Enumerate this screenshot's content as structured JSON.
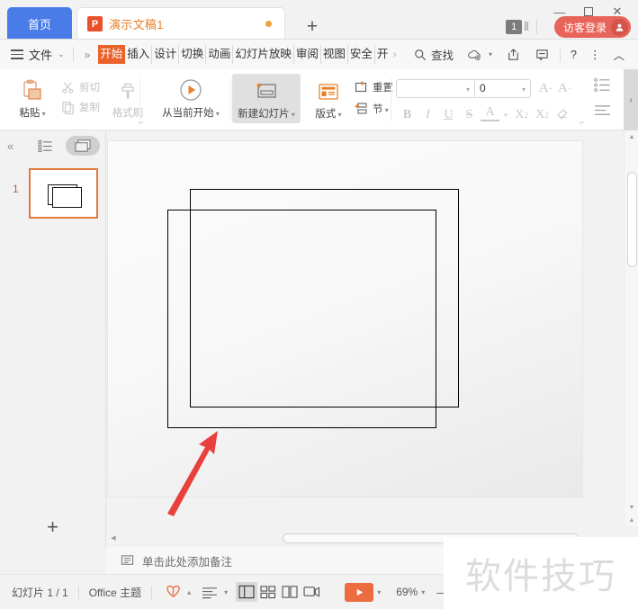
{
  "titlebar": {
    "home_tab": "首页",
    "doc_tab": {
      "icon_letter": "P",
      "label": "演示文稿1"
    },
    "add_tab": "+",
    "window_controls": {
      "minimize": "—",
      "maximize": "▢",
      "close": "✕"
    },
    "counter": "1",
    "guest": {
      "label": "访客登录",
      "avatar_glyph": "👤"
    }
  },
  "menubar": {
    "file": "文件",
    "file_caret": "⌄",
    "expand_more": "»",
    "tabs": [
      {
        "label": "开始",
        "active": true
      },
      {
        "label": "插入",
        "active": false
      },
      {
        "label": "设计",
        "active": false
      },
      {
        "label": "切换",
        "active": false
      },
      {
        "label": "动画",
        "active": false
      },
      {
        "label": "幻灯片放映",
        "active": false
      },
      {
        "label": "审阅",
        "active": false
      },
      {
        "label": "视图",
        "active": false
      },
      {
        "label": "安全",
        "active": false
      },
      {
        "label": "开",
        "active": false
      }
    ],
    "tabs_overflow": "›",
    "search": "查找",
    "cloud_caret": "▾",
    "help": "?",
    "more": "⋮",
    "collapse": "︿"
  },
  "ribbon": {
    "clipboard": {
      "paste": "粘贴",
      "paste_caret": "▾",
      "cut": "剪切",
      "copy": "复制",
      "format_painter": "格式刷"
    },
    "start_show": {
      "label": "从当前开始",
      "caret": "▾"
    },
    "slides": {
      "new_slide": "新建幻灯片",
      "new_slide_caret": "▾",
      "layout": "版式",
      "layout_caret": "▾",
      "reset": "重置",
      "section": "节",
      "section_caret": "▾"
    },
    "font": {
      "name_value": "",
      "name_placeholder": "",
      "size_value": "0",
      "grow": "A",
      "grow_sup": "+",
      "shrink": "A",
      "shrink_sup": "−",
      "bold": "B",
      "italic": "I",
      "underline": "U",
      "strikethrough": "S",
      "text_color": "A",
      "text_color_caret": "▾",
      "superscript": "X",
      "superscript_sup": "2",
      "subscript": "X",
      "subscript_sub": "2",
      "clear_format": "◇"
    },
    "collapse_arrow": "›"
  },
  "left_panel": {
    "collapse": "«",
    "outline_view": "outline",
    "slide_view": "slides",
    "slides": [
      {
        "number": "1"
      }
    ],
    "add_slide": "+"
  },
  "canvas": {
    "shapes": [
      {
        "name": "rectangle-back"
      },
      {
        "name": "rectangle-front"
      }
    ],
    "annotation_arrow": {
      "color": "#e8413c"
    }
  },
  "notes": {
    "placeholder": "单击此处添加备注"
  },
  "statusbar": {
    "slide_count": "幻灯片 1 / 1",
    "theme": "Office 主题",
    "theme_caret": "▴",
    "lang_caret": "▾",
    "play_caret": "▾",
    "zoom": "69%",
    "zoom_caret": "▾",
    "zoom_out": "—"
  },
  "watermark": {
    "text": "软件技巧"
  },
  "colors": {
    "accent_orange": "#e8622a",
    "home_blue": "#4a7ce8",
    "guest_red": "#e8645a",
    "thumb_border": "#e07b3c",
    "arrow_red": "#e8413c"
  }
}
